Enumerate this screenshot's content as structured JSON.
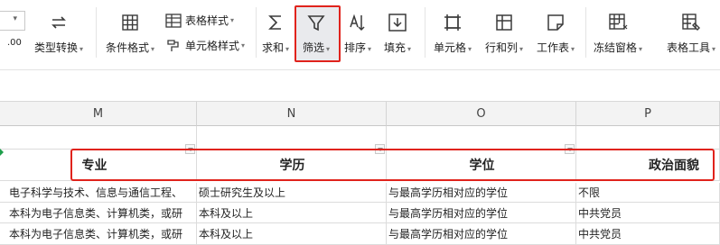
{
  "toolbar": {
    "number_format": {
      "label": "类型转换"
    },
    "conditional_format": {
      "label": "条件格式"
    },
    "table_style": {
      "label": "表格样式"
    },
    "cell_style": {
      "label": "单元格样式"
    },
    "sum": {
      "label": "求和"
    },
    "filter": {
      "label": "筛选"
    },
    "sort": {
      "label": "排序"
    },
    "fill": {
      "label": "填充"
    },
    "cell": {
      "label": "单元格"
    },
    "row_col": {
      "label": "行和列"
    },
    "worksheet": {
      "label": "工作表"
    },
    "freeze": {
      "label": "冻结窗格"
    },
    "table_tools": {
      "label": "表格工具"
    },
    "decimal_label": ".00"
  },
  "sheet": {
    "columns": [
      "M",
      "N",
      "O",
      "P"
    ],
    "headers": [
      "专业",
      "学历",
      "学位",
      "政治面貌"
    ],
    "rows": [
      [
        "电子科学与技术、信息与通信工程、",
        "硕士研究生及以上",
        "与最高学历相对应的学位",
        "不限"
      ],
      [
        "本科为电子信息类、计算机类，或研",
        "本科及以上",
        "与最高学历相对应的学位",
        "中共党员"
      ],
      [
        "本科为电子信息类、计算机类，或研",
        "本科及以上",
        "与最高学历相对应的学位",
        "中共党员"
      ]
    ]
  },
  "colors": {
    "highlight": "#e0231c",
    "ribbon_icon": "#3a3a3a"
  }
}
